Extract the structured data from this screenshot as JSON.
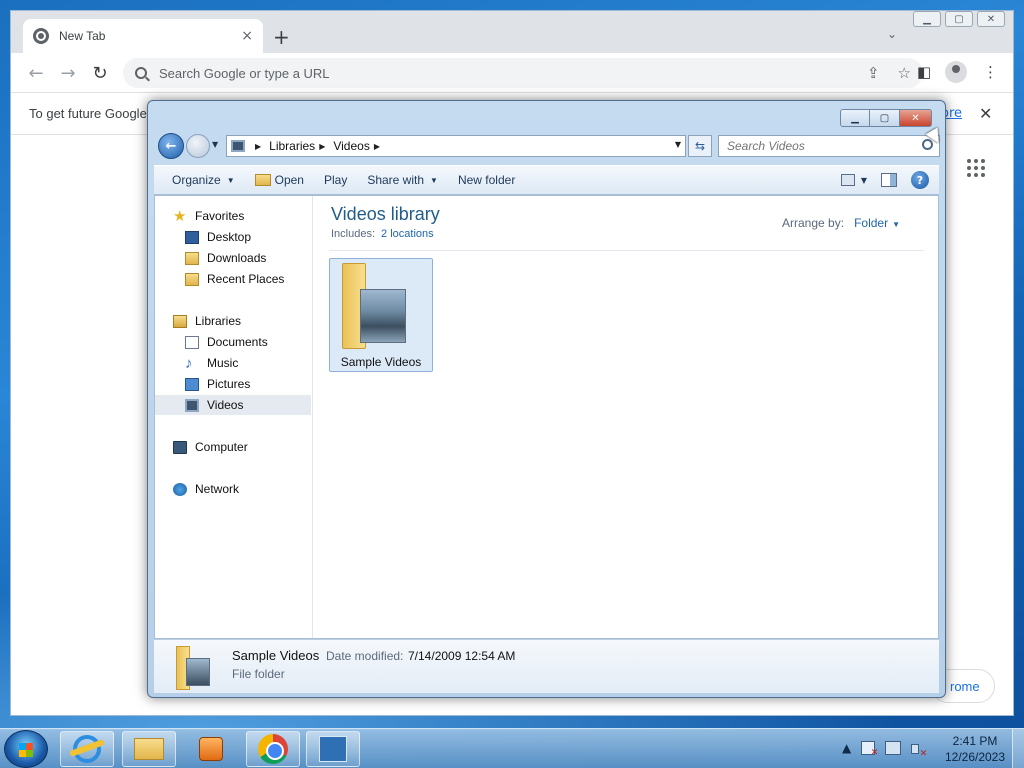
{
  "chrome": {
    "tab_title": "New Tab",
    "tab_close": "×",
    "new_tab": "+",
    "omnibox_placeholder": "Search Google or type a URL",
    "infobar_message": "To get future Google",
    "infobar_link": "ore",
    "customize_label": "rome",
    "icons": [
      "chrome-favicon-icon",
      "back-icon",
      "forward-icon",
      "reload-icon",
      "search-icon",
      "share-icon",
      "star-icon",
      "side-panel-icon",
      "profile-icon",
      "menu-icon",
      "apps-grid-icon"
    ]
  },
  "explorer": {
    "breadcrumb": [
      "Libraries",
      "Videos"
    ],
    "search_placeholder": "Search Videos",
    "commands": {
      "organize": "Organize",
      "open": "Open",
      "play": "Play",
      "share_with": "Share with",
      "new_folder": "New folder"
    },
    "nav": {
      "favorites": "Favorites",
      "desktop": "Desktop",
      "downloads": "Downloads",
      "recent_places": "Recent Places",
      "libraries": "Libraries",
      "documents": "Documents",
      "music": "Music",
      "pictures": "Pictures",
      "videos": "Videos",
      "computer": "Computer",
      "network": "Network"
    },
    "library_title": "Videos library",
    "includes_label": "Includes:",
    "includes_link": "2 locations",
    "arrange_label": "Arrange by:",
    "arrange_value": "Folder",
    "items": [
      {
        "name": "Sample Videos"
      }
    ],
    "details": {
      "name": "Sample Videos",
      "date_label": "Date modified:",
      "date_value": "7/14/2009 12:54 AM",
      "type": "File folder"
    }
  },
  "taskbar": {
    "time": "2:41 PM",
    "date": "12/26/2023",
    "tray_arrow": "▲"
  },
  "colors": {
    "explorer_title": "#1e5d8a",
    "link": "#1f64b0",
    "close_button": "#c9442f",
    "chrome_link": "#1a73e8"
  }
}
